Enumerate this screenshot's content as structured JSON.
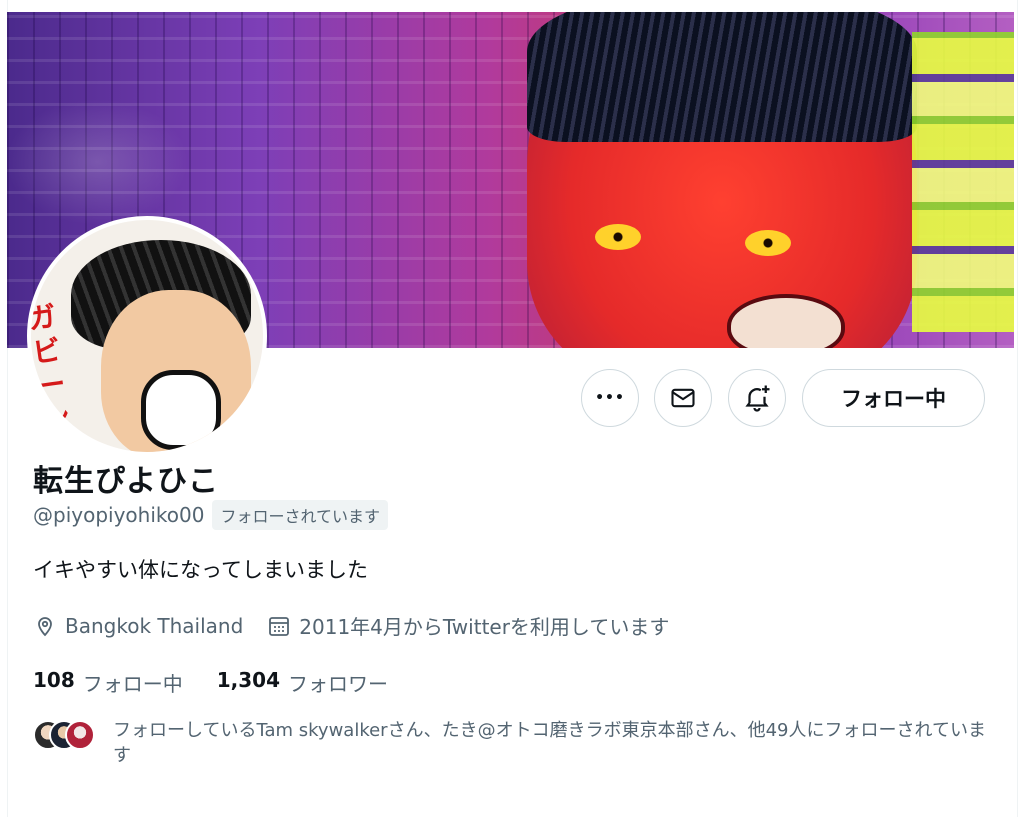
{
  "profile": {
    "display_name": "転生ぴよひこ",
    "handle": "@piyopiyohiko00",
    "follows_you_badge": "フォローされています",
    "bio": "イキやすい体になってしまいました",
    "location": "Bangkok Thailand",
    "joined": "2011年4月からTwitterを利用しています",
    "avatar_sfx": "ガビーン"
  },
  "actions": {
    "more_glyph": "•••",
    "follow_button_label": "フォロー中"
  },
  "stats": {
    "following_count": "108",
    "following_label": "フォロー中",
    "followers_count": "1,304",
    "followers_label": "フォロワー"
  },
  "followers_you_know": {
    "text": "フォローしているTam skywalkerさん、たき@オトコ磨きラボ東京本部さん、他49人にフォローされています"
  },
  "icons": {
    "location": "location-pin-icon",
    "calendar": "calendar-icon",
    "mail": "mail-icon",
    "bell": "bell-plus-icon",
    "more": "more-dots-icon"
  },
  "colors": {
    "primary_text": "#0f1419",
    "secondary_text": "#536471",
    "border": "#cfd9de",
    "badge_bg": "#eff3f4"
  }
}
